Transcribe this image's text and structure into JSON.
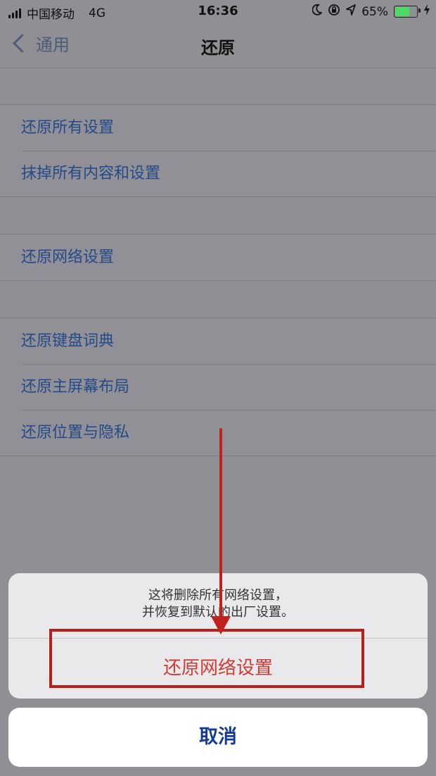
{
  "status_bar": {
    "carrier": "中国移动",
    "network": "4G",
    "time": "16:36",
    "battery_percent": "65%",
    "battery_level": 0.65
  },
  "nav": {
    "back_label": "通用",
    "title": "还原"
  },
  "groups": [
    [
      "还原所有设置",
      "抹掉所有内容和设置"
    ],
    [
      "还原网络设置"
    ],
    [
      "还原键盘词典",
      "还原主屏幕布局",
      "还原位置与隐私"
    ]
  ],
  "action_sheet": {
    "message_line1": "这将删除所有网络设置，",
    "message_line2": "并恢复到默认的出厂设置。",
    "confirm_label": "还原网络设置",
    "cancel_label": "取消"
  },
  "colors": {
    "link_blue": "#244a88",
    "destructive_red": "#d33a35",
    "annotation_red": "#c0211c"
  }
}
